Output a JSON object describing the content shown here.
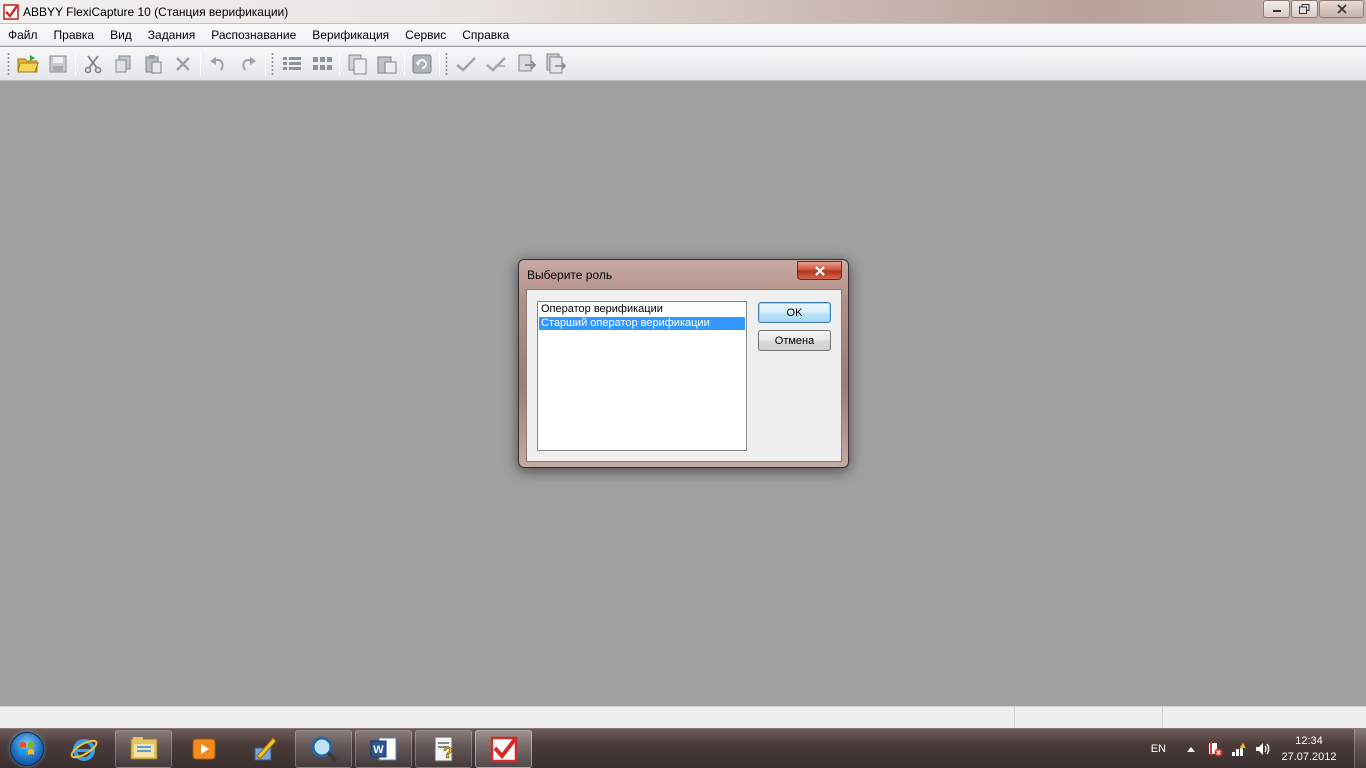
{
  "window": {
    "title": "ABBYY FlexiCapture 10 (Станция верификации)",
    "controls": {
      "minimize": "minimize-icon",
      "maximize": "restore-icon",
      "close": "close-icon"
    }
  },
  "menu": [
    {
      "label": "Файл"
    },
    {
      "label": "Правка"
    },
    {
      "label": "Вид"
    },
    {
      "label": "Задания"
    },
    {
      "label": "Распознавание"
    },
    {
      "label": "Верификация"
    },
    {
      "label": "Сервис"
    },
    {
      "label": "Справка"
    }
  ],
  "toolbar": {
    "icons": [
      "open-folder-icon",
      "save-icon",
      "cut-icon",
      "copy-icon",
      "paste-icon",
      "delete-icon",
      "undo-icon",
      "redo-icon",
      "list-view-icon",
      "thumbnails-view-icon",
      "copy-page-icon",
      "paste-page-icon",
      "refresh-icon",
      "verify-icon",
      "verify-all-icon",
      "export-icon",
      "export-all-icon"
    ]
  },
  "dialog": {
    "title": "Выберите роль",
    "roles": [
      {
        "label": "Оператор верификации",
        "selected": false
      },
      {
        "label": "Старший оператор верификации",
        "selected": true
      }
    ],
    "ok_label": "OK",
    "cancel_label": "Отмена"
  },
  "taskbar": {
    "apps": [
      "internet-explorer-icon",
      "file-explorer-icon",
      "media-player-icon",
      "pen-tool-icon",
      "search-magnifier-icon",
      "word-icon",
      "help-icon",
      "flexicapture-icon"
    ],
    "language": "EN",
    "time": "12:34",
    "date": "27.07.2012"
  },
  "colors": {
    "selection": "#3399ff",
    "workspace": "#a0a0a0",
    "app_red": "#d42a2a"
  }
}
